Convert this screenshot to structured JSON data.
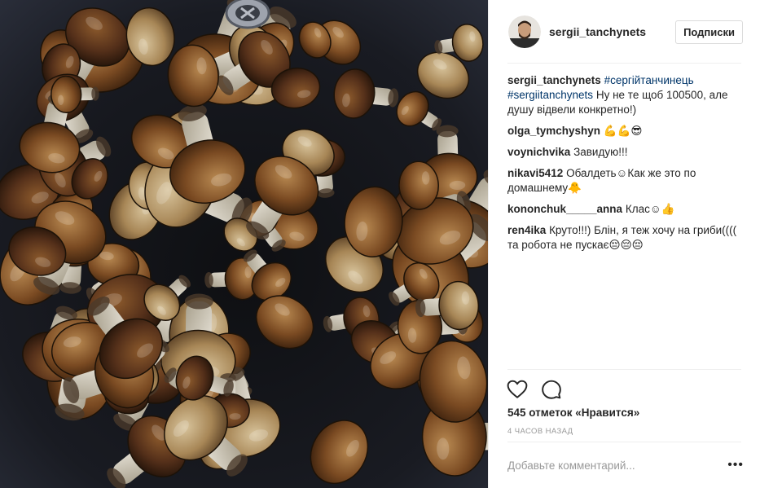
{
  "post": {
    "photo": {
      "subject": "bowl of porcini mushrooms in dark sink"
    },
    "header": {
      "username": "sergii_tanchynets",
      "follow_label": "Подписки"
    },
    "caption": {
      "username": "sergii_tanchynets",
      "hashtag1": "#сергійтанчинець",
      "hashtag2": "#sergiitanchynets",
      "text": "Ну не те щоб 100500, але душу відвели конкретно!)"
    },
    "comments": [
      {
        "user": "olga_tymchyshyn",
        "text": "💪💪😎"
      },
      {
        "user": "voynichvika",
        "text": "Завидую!!!"
      },
      {
        "user": "nikavi5412",
        "text": "Обалдеть☺Как же это по домашнему🐥"
      },
      {
        "user": "kononchuk_____anna",
        "text": "Клас☺👍"
      },
      {
        "user": "ren4ika",
        "text": "Круто!!!) Блін, я теж хочу на гриби(((( та робота не пускає😔😔😔"
      }
    ],
    "actions": {
      "like_icon": "heart-icon",
      "comment_icon": "comment-icon"
    },
    "likes_text": "545 отметок «Нравится»",
    "time_ago": "4 часов назад",
    "comment_placeholder": "Добавьте комментарий...",
    "more_label": "•••",
    "colors": {
      "link": "#003569",
      "muted": "#999999",
      "text": "#262626",
      "divider": "#efefef"
    }
  }
}
